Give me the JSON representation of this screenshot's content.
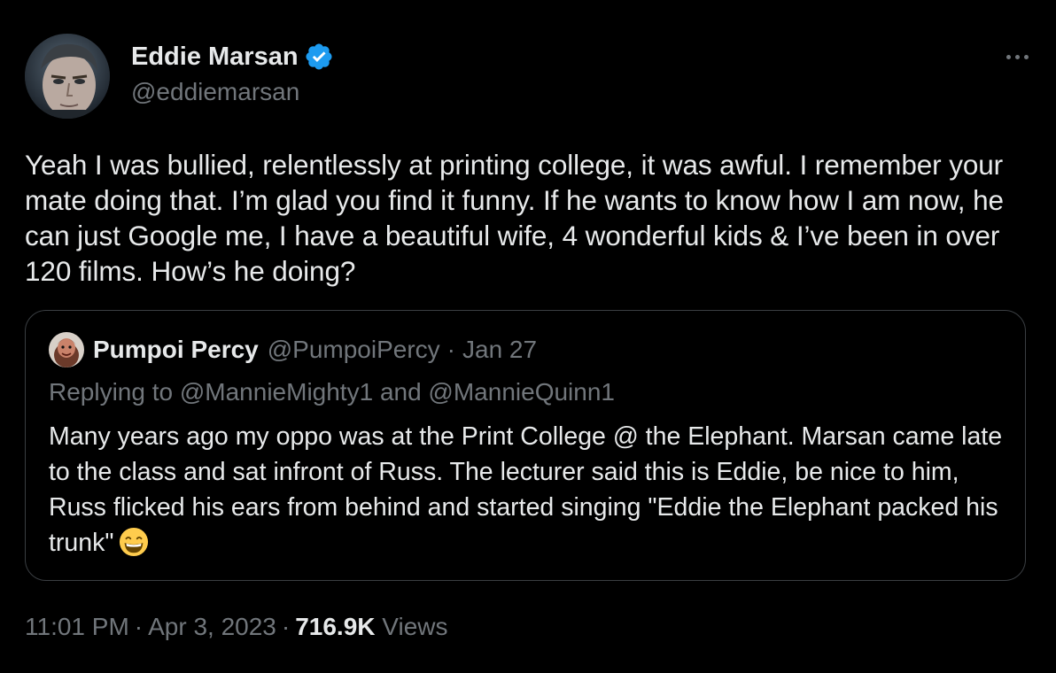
{
  "tweet": {
    "author": {
      "display_name": "Eddie Marsan",
      "handle": "@eddiemarsan",
      "verified": true
    },
    "text": "Yeah I was bullied, relentlessly at printing college, it was awful. I remember your mate doing that. I’m glad you find it funny. If he wants to know how I am now, he can just Google me, I have a beautiful wife, 4 wonderful kids & I’ve been in over 120 films. How’s he doing?",
    "more_icon": "more-horizontal-icon",
    "time": "11:01 PM",
    "date": "Apr 3, 2023",
    "views_count": "716.9K",
    "views_label": "Views",
    "meta_separator": "·"
  },
  "quoted_tweet": {
    "display_name": "Pumpoi Percy",
    "handle": "@PumpoiPercy",
    "separator": "·",
    "date": "Jan 27",
    "reply_to": "Replying to @MannieMighty1 and @MannieQuinn1",
    "text": "Many years ago my oppo was at the Print College @ the Elephant. Marsan came late to the class and sat infront of Russ. The lecturer said this is Eddie, be nice to him, Russ flicked his ears from behind and started singing \"Eddie the Elephant packed his trunk\"",
    "emoji": "grinning-face-with-smiling-eyes-icon"
  },
  "colors": {
    "background": "#000000",
    "text_primary": "#e7e9ea",
    "text_secondary": "#71767b",
    "border": "#3a3e42",
    "verified_blue": "#1d9bf0"
  }
}
